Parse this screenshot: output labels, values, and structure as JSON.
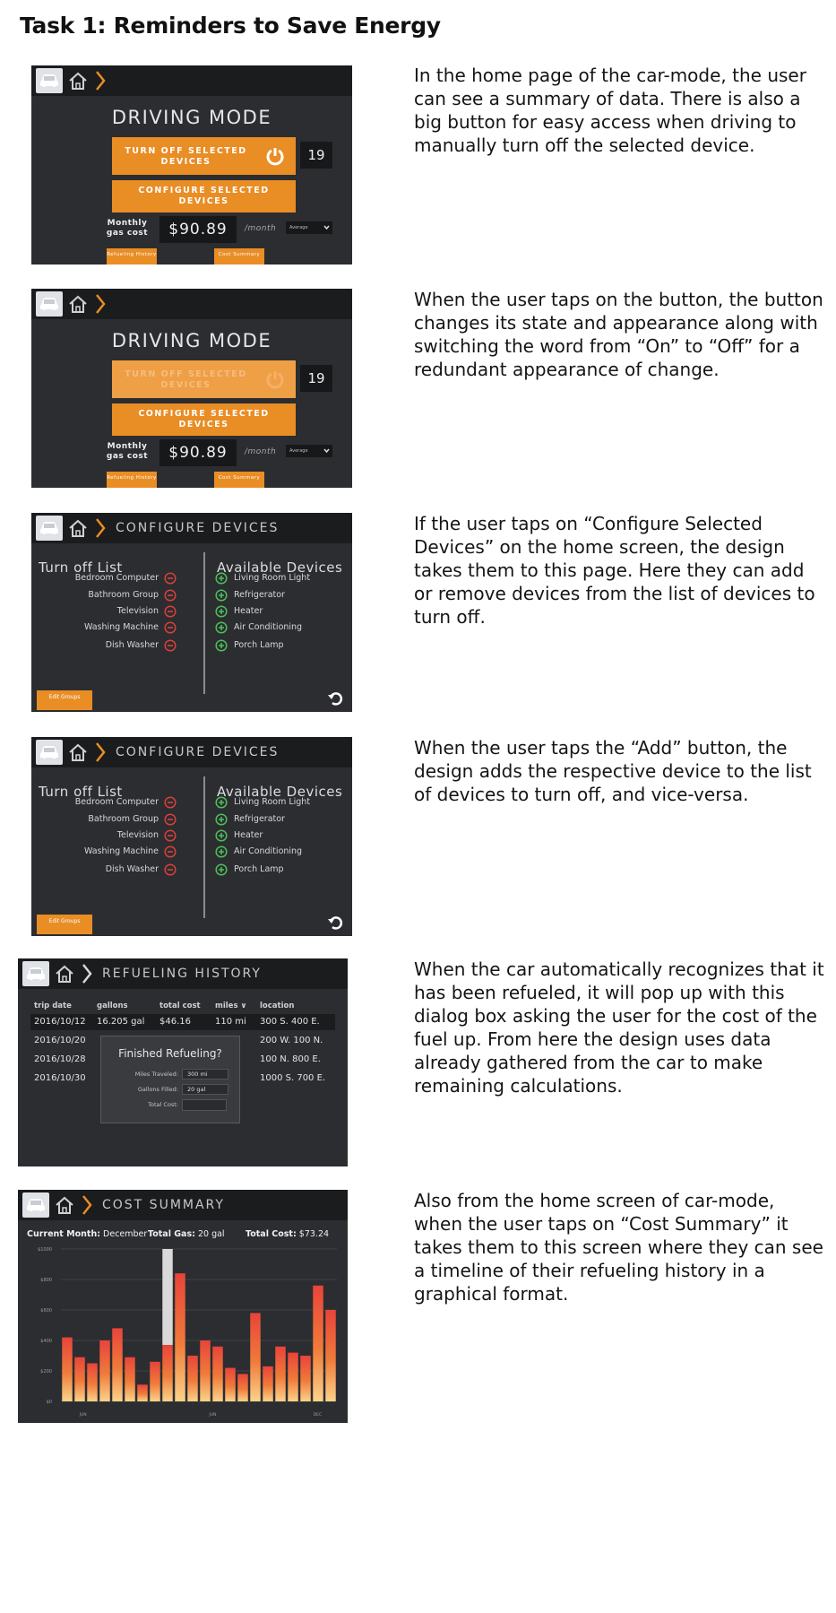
{
  "task_title": "Task 1: Reminders to Save Energy",
  "sections": [
    {
      "description": "In the home page of the car-mode, the user can see a summary of data. There is also a big button for easy access when driving to manually turn off the selected device."
    },
    {
      "description": "When the user taps on the button, the button changes its state and appearance along with switching the word from “On” to “Off” for a redundant appearance of change."
    },
    {
      "description": "If the user taps on “Configure Selected Devices” on the home screen, the design takes them to this page. Here they can add or remove devices from the list of devices to turn off."
    },
    {
      "description": "When the user taps the “Add” button, the design adds the respective device to the list of devices to turn off, and vice-versa."
    },
    {
      "description": "When the car automatically recognizes that it has been refueled, it will pop up with this dialog box asking the user for the cost of the fuel up. From here the design uses data already gathered from the car to make remaining calculations."
    },
    {
      "description": "Also from the home screen of car-mode, when the user taps on “Cost Summary” it takes them to this screen where they can see a timeline of their refueling history in a graphical format."
    }
  ],
  "icons": {
    "car": "car-icon",
    "home": "home-icon",
    "chevron": "chevron-right-icon",
    "power": "power-icon",
    "minus": "minus-circle-icon",
    "plus": "plus-circle-icon",
    "undo": "undo-icon",
    "dropdown": "chevron-down-icon"
  },
  "colors": {
    "accent": "#e98d25",
    "screen_bg": "#2c2d30",
    "bar_bg": "#1b1c1e",
    "minus": "#d9403a",
    "plus": "#4cc05a"
  },
  "driving_mode": {
    "title": "DRIVING MODE",
    "turn_off_label": "TURN OFF SELECTED DEVICES",
    "configure_label": "CONFIGURE SELECTED DEVICES",
    "device_count": "19",
    "gas_label": "Monthly gas cost",
    "gas_value": "$90.89",
    "per_month": "/month",
    "select_value": "Average",
    "refueling_btn": "Refueling History",
    "cost_btn": "Cost Summary"
  },
  "configure": {
    "title": "CONFIGURE DEVICES",
    "left_header": "Turn off List",
    "right_header": "Available Devices",
    "turn_off_list": [
      "Bedroom Computer",
      "Bathroom Group",
      "Television",
      "Washing Machine",
      "Dish Washer"
    ],
    "available": [
      "Living Room Light",
      "Refrigerator",
      "Heater",
      "Air Conditioning",
      "Porch Lamp"
    ],
    "edit_btn": "Edit Groups"
  },
  "refueling": {
    "title": "REFUELING HISTORY",
    "headers": [
      "trip date",
      "gallons",
      "total cost",
      "miles ∨",
      "location"
    ],
    "rows": [
      [
        "2016/10/12",
        "16.205 gal",
        "$46.16",
        "110 mi",
        "300 S. 400 E."
      ],
      [
        "2016/10/20",
        "",
        "",
        "",
        "200 W. 100 N."
      ],
      [
        "2016/10/28",
        "",
        "",
        "",
        "100 N. 800 E."
      ],
      [
        "2016/10/30",
        "",
        "",
        "",
        "1000 S. 700 E."
      ]
    ],
    "dialog": {
      "title": "Finished Refueling?",
      "fields": [
        {
          "label": "Miles Traveled:",
          "value": "300 mi"
        },
        {
          "label": "Gallons Filled:",
          "value": "20 gal"
        },
        {
          "label": "Total Cost:",
          "value": ""
        }
      ]
    }
  },
  "cost_summary": {
    "title": "COST SUMMARY",
    "current_month_label": "Current Month:",
    "current_month": "December",
    "total_gas_label": "Total Gas:",
    "total_gas": "20 gal",
    "total_cost_label": "Total Cost:",
    "total_cost": "$73.24"
  },
  "chart_data": {
    "type": "bar",
    "y_ticks": [
      "$1000",
      "$800",
      "$600",
      "$400",
      "$200",
      "$0"
    ],
    "x_ticks": [
      "JUN",
      "JUN",
      "DEC"
    ],
    "ylim": [
      0,
      1000
    ],
    "values": [
      420,
      290,
      250,
      400,
      480,
      290,
      110,
      260,
      370,
      840,
      300,
      400,
      360,
      220,
      180,
      580,
      230,
      360,
      320,
      300,
      760,
      600
    ],
    "highlight_index": 8,
    "highlight_top": 1000,
    "grid": true
  }
}
